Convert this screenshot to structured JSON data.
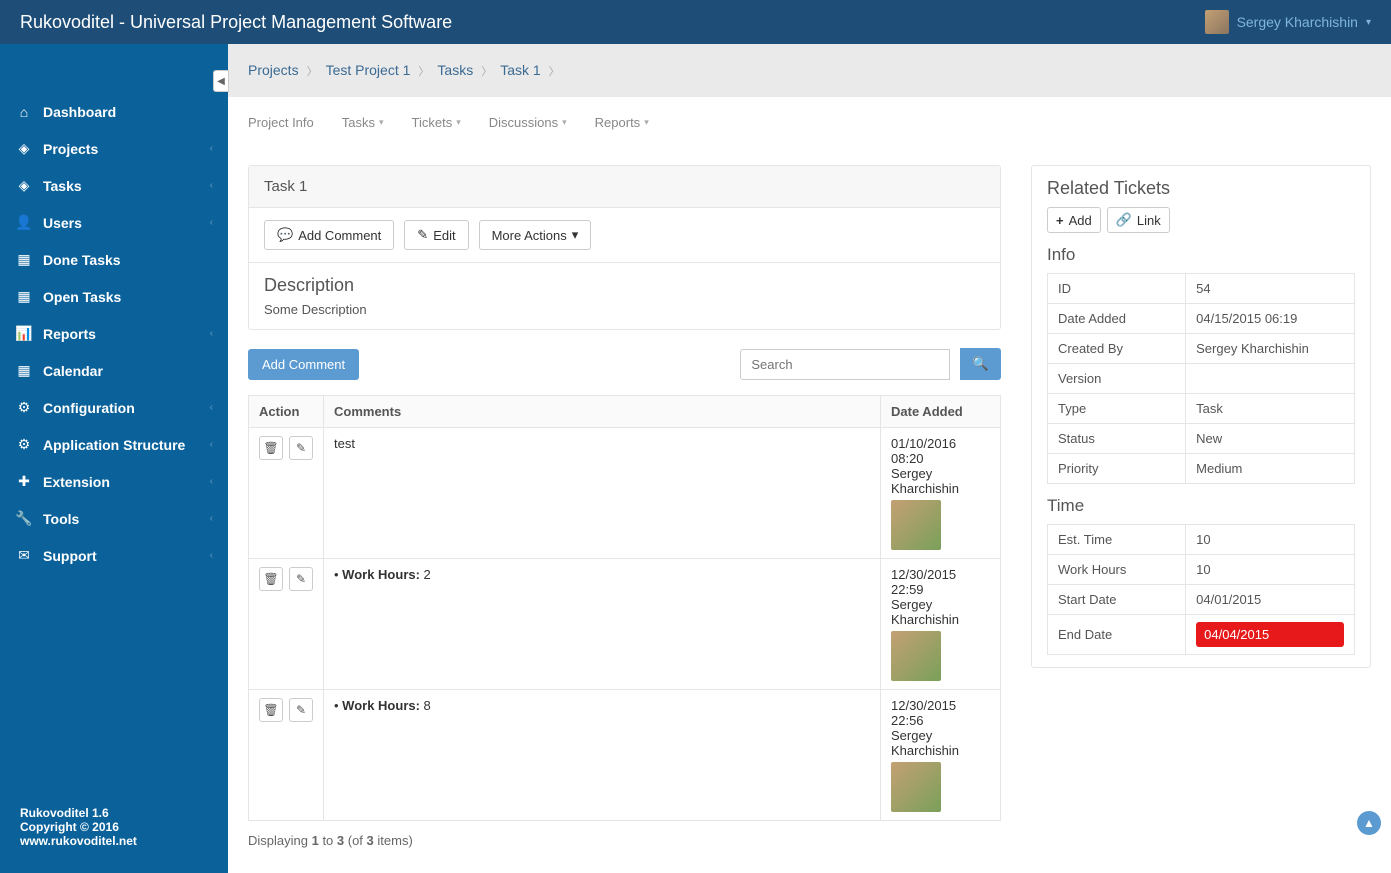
{
  "header": {
    "title": "Rukovoditel - Universal Project Management Software",
    "user_name": "Sergey Kharchishin"
  },
  "sidebar": {
    "items": [
      {
        "icon": "⌂",
        "label": "Dashboard",
        "expandable": false
      },
      {
        "icon": "◈",
        "label": "Projects",
        "expandable": true
      },
      {
        "icon": "◈",
        "label": "Tasks",
        "expandable": true
      },
      {
        "icon": "👤",
        "label": "Users",
        "expandable": true
      },
      {
        "icon": "▦",
        "label": "Done Tasks",
        "expandable": false
      },
      {
        "icon": "▦",
        "label": "Open Tasks",
        "expandable": false
      },
      {
        "icon": "📊",
        "label": "Reports",
        "expandable": true
      },
      {
        "icon": "▦",
        "label": "Calendar",
        "expandable": false
      },
      {
        "icon": "⚙",
        "label": "Configuration",
        "expandable": true
      },
      {
        "icon": "⚙",
        "label": "Application Structure",
        "expandable": true
      },
      {
        "icon": "✚",
        "label": "Extension",
        "expandable": true
      },
      {
        "icon": "🔧",
        "label": "Tools",
        "expandable": true
      },
      {
        "icon": "✉",
        "label": "Support",
        "expandable": true
      }
    ]
  },
  "footer": {
    "line1": "Rukovoditel 1.6",
    "line2_prefix": "Copyright © 2016 ",
    "line2_link": "www.rukovoditel.net"
  },
  "breadcrumb": [
    "Projects",
    "Test Project 1",
    "Tasks",
    "Task 1"
  ],
  "tabs": [
    {
      "label": "Project Info",
      "caret": false
    },
    {
      "label": "Tasks",
      "caret": true
    },
    {
      "label": "Tickets",
      "caret": true
    },
    {
      "label": "Discussions",
      "caret": true
    },
    {
      "label": "Reports",
      "caret": true
    }
  ],
  "task": {
    "title": "Task 1",
    "btn_add_comment": "Add Comment",
    "btn_edit": "Edit",
    "btn_more": "More Actions",
    "desc_heading": "Description",
    "desc_text": "Some Description"
  },
  "comments_section": {
    "btn_add": "Add Comment",
    "search_placeholder": "Search",
    "cols": {
      "action": "Action",
      "comments": "Comments",
      "date": "Date Added"
    },
    "rows": [
      {
        "text": "test",
        "work_hours_label": "",
        "work_hours": "",
        "date": "01/10/2016 08:20",
        "author": "Sergey Kharchishin"
      },
      {
        "text": "",
        "work_hours_label": "Work Hours:",
        "work_hours": "2",
        "date": "12/30/2015 22:59",
        "author": "Sergey Kharchishin"
      },
      {
        "text": "",
        "work_hours_label": "Work Hours:",
        "work_hours": "8",
        "date": "12/30/2015 22:56",
        "author": "Sergey Kharchishin"
      }
    ],
    "pager_prefix": "Displaying ",
    "pager_from": "1",
    "pager_to_word": " to ",
    "pager_to": "3",
    "pager_of_prefix": " (of ",
    "pager_total": "3",
    "pager_suffix": " items)"
  },
  "side": {
    "related_heading": "Related Tickets",
    "btn_add": "Add",
    "btn_link": "Link",
    "info_heading": "Info",
    "info_rows": [
      {
        "k": "ID",
        "v": "54"
      },
      {
        "k": "Date Added",
        "v": "04/15/2015 06:19"
      },
      {
        "k": "Created By",
        "v": "Sergey Kharchishin"
      },
      {
        "k": "Version",
        "v": ""
      },
      {
        "k": "Type",
        "v": "Task"
      },
      {
        "k": "Status",
        "v": "New"
      },
      {
        "k": "Priority",
        "v": "Medium"
      }
    ],
    "time_heading": "Time",
    "time_rows": [
      {
        "k": "Est. Time",
        "v": "10",
        "danger": false
      },
      {
        "k": "Work Hours",
        "v": "10",
        "danger": false
      },
      {
        "k": "Start Date",
        "v": "04/01/2015",
        "danger": false
      },
      {
        "k": "End Date",
        "v": "04/04/2015",
        "danger": true
      }
    ]
  }
}
